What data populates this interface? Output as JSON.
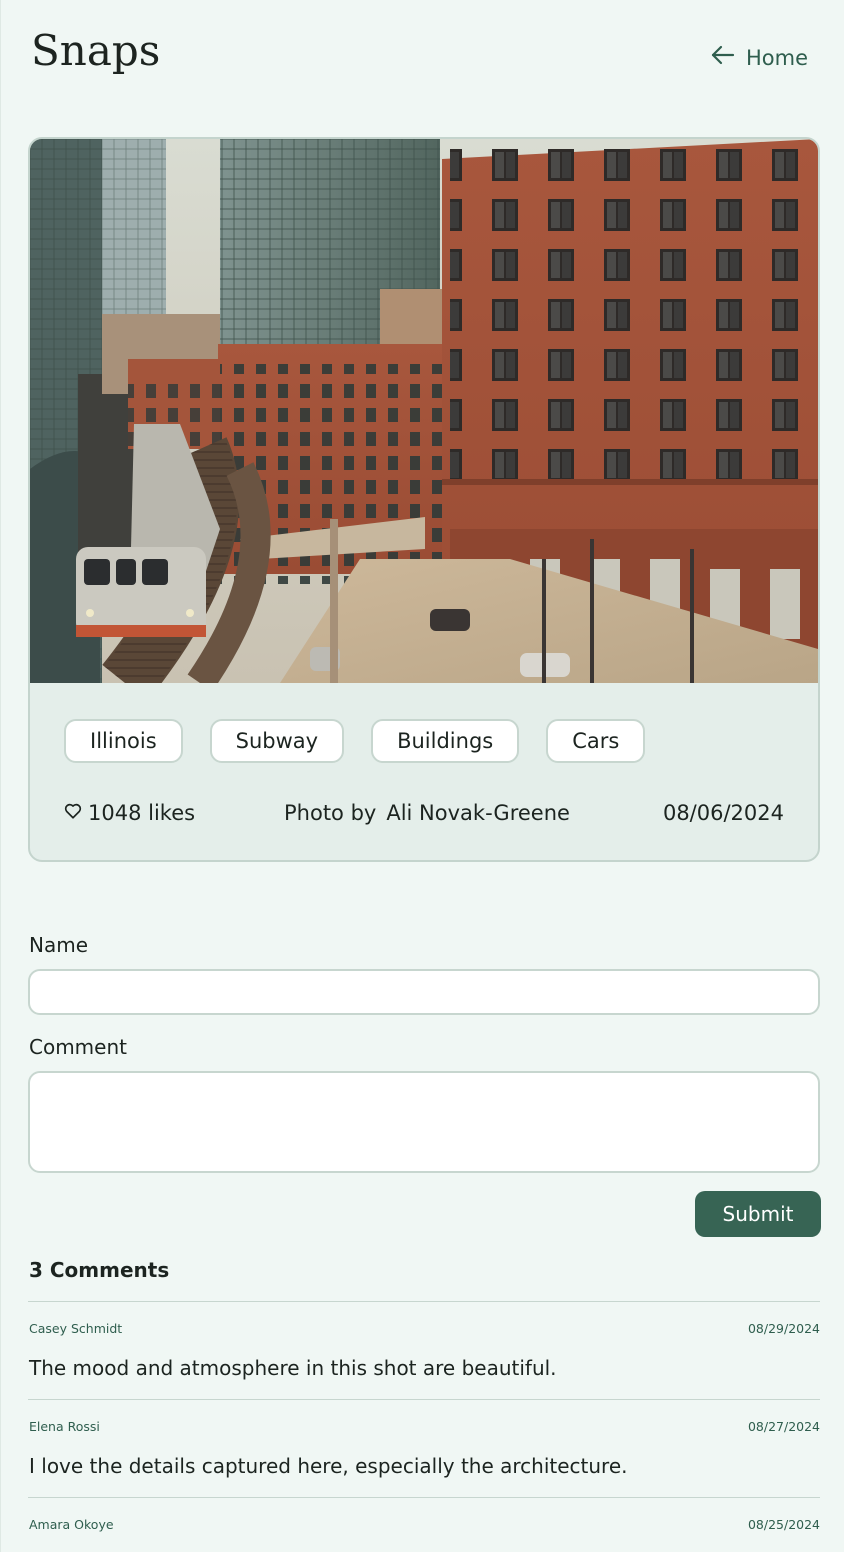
{
  "header": {
    "title": "Snaps",
    "home_label": "Home"
  },
  "photo": {
    "tags": [
      "Illinois",
      "Subway",
      "Buildings",
      "Cars"
    ],
    "likes_text": "1048 likes",
    "credit_prefix": "Photo by",
    "photographer": "Ali Novak-Greene",
    "date": "08/06/2024"
  },
  "form": {
    "name_label": "Name",
    "name_value": "",
    "comment_label": "Comment",
    "comment_value": "",
    "submit_label": "Submit"
  },
  "comments": {
    "count_label": "3 Comments",
    "items": [
      {
        "author": "Casey Schmidt",
        "date": "08/29/2024",
        "text": "The mood and atmosphere in this shot are beautiful."
      },
      {
        "author": "Elena Rossi",
        "date": "08/27/2024",
        "text": "I love the details captured here, especially the architecture."
      },
      {
        "author": "Amara Okoye",
        "date": "08/25/2024",
        "text": ""
      }
    ]
  },
  "colors": {
    "background": "#f0f7f4",
    "accent": "#376454",
    "link": "#2f5e4e",
    "card_background": "#e4eeea"
  },
  "icons": {
    "home": "arrow-left-icon",
    "likes": "heart-icon"
  }
}
